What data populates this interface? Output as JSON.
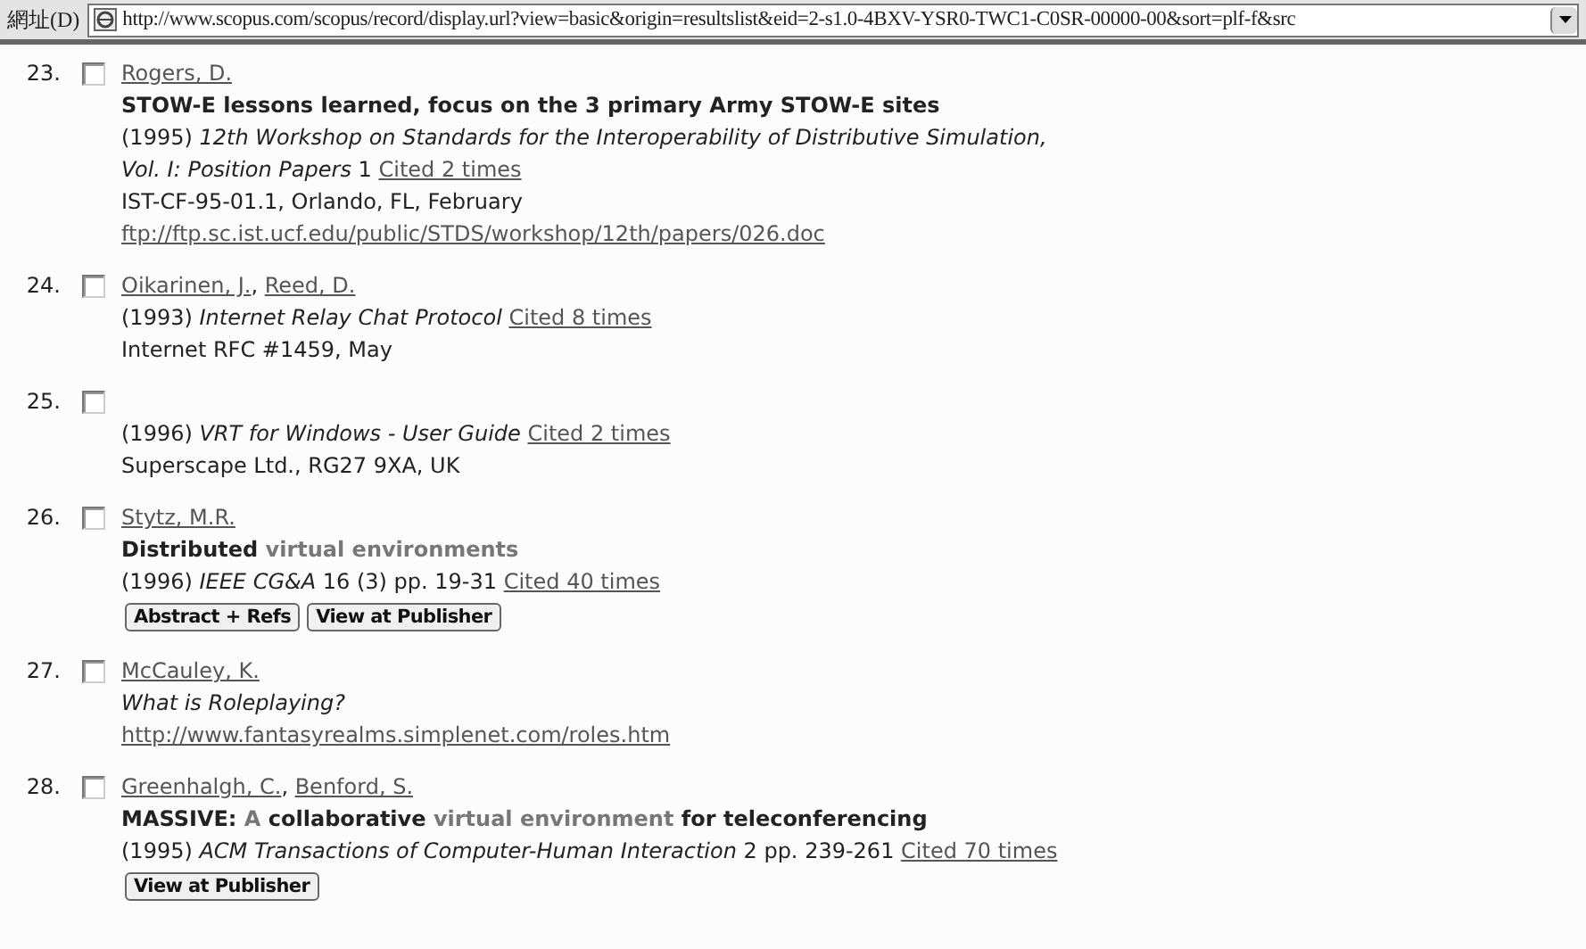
{
  "address_bar": {
    "label": "網址(D)",
    "url": "http://www.scopus.com/scopus/record/display.url?view=basic&origin=resultslist&eid=2-s1.0-4BXV-YSR0-TWC1-C0SR-00000-00&sort=plf-f&src"
  },
  "author_separator": ", ",
  "references": [
    {
      "number": "23.",
      "checked": false,
      "authors": [
        "Rogers, D."
      ],
      "title": [
        {
          "text": "STOW-E lessons learned, focus on the 3 primary Army STOW-E sites",
          "highlight": false
        }
      ],
      "source": [
        "(1995) *12th Workshop on Standards for the Interoperability of Distributive Simulation,*",
        "*Vol. I: Position Papers* 1"
      ],
      "cited": "Cited 2 times",
      "lines": [
        {
          "kind": "text",
          "text": "IST-CF-95-01.1, Orlando, FL, February"
        },
        {
          "kind": "link",
          "text": "ftp://ftp.sc.ist.ucf.edu/public/STDS/workshop/12th/papers/026.doc"
        }
      ]
    },
    {
      "number": "24.",
      "checked": false,
      "authors": [
        "Oikarinen, J.",
        "Reed, D."
      ],
      "source": [
        "(1993) *Internet Relay Chat Protocol*"
      ],
      "cited": "Cited 8 times",
      "lines": [
        {
          "kind": "text",
          "text": "Internet RFC #1459, May"
        }
      ]
    },
    {
      "number": "25.",
      "checked": false,
      "source": [
        "(1996) *VRT for Windows - User Guide*"
      ],
      "cited": "Cited 2 times",
      "lines": [
        {
          "kind": "text",
          "text": "Superscape Ltd., RG27 9XA, UK"
        }
      ]
    },
    {
      "number": "26.",
      "checked": false,
      "authors": [
        "Stytz, M.R."
      ],
      "title": [
        {
          "text": "Distributed",
          "highlight": false
        },
        {
          "text": "virtual environments",
          "highlight": true
        }
      ],
      "source": [
        "(1996) *IEEE CG&A* 16 (3) pp. 19-31"
      ],
      "cited": "Cited 40 times",
      "buttons": [
        "Abstract + Refs",
        "View at Publisher"
      ]
    },
    {
      "number": "27.",
      "checked": false,
      "authors": [
        "McCauley, K."
      ],
      "lines": [
        {
          "kind": "italic",
          "text": "What is Roleplaying?"
        },
        {
          "kind": "link",
          "text": "http://www.fantasyrealms.simplenet.com/roles.htm"
        }
      ]
    },
    {
      "number": "28.",
      "checked": false,
      "authors": [
        "Greenhalgh, C.",
        "Benford, S."
      ],
      "title": [
        {
          "text": "MASSIVE:",
          "highlight": false
        },
        {
          "text": "A",
          "highlight": true
        },
        {
          "text": "collaborative",
          "highlight": false
        },
        {
          "text": "virtual environment",
          "highlight": true
        },
        {
          "text": "for teleconferencing",
          "highlight": false
        }
      ],
      "source": [
        "(1995) *ACM Transactions of Computer-Human Interaction* 2 pp. 239-261"
      ],
      "cited": "Cited 70 times",
      "buttons": [
        "View at Publisher"
      ]
    }
  ]
}
